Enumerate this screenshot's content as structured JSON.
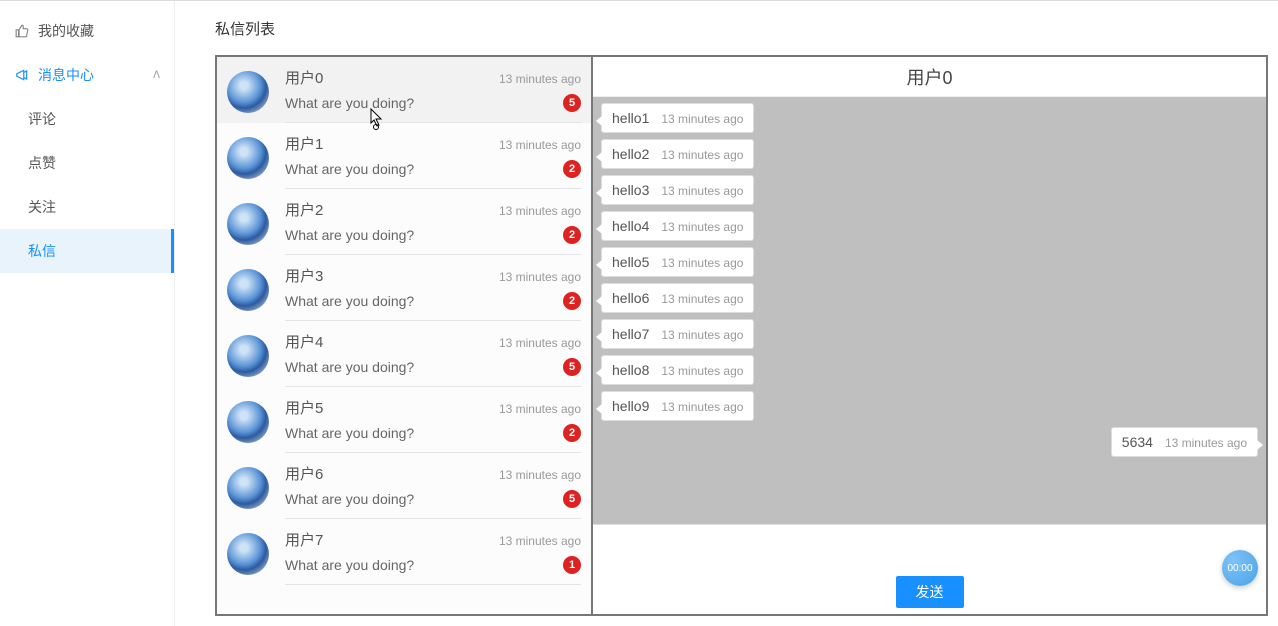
{
  "sidebar": {
    "favorites": "我的收藏",
    "message_center": "消息中心",
    "sub": {
      "comments": "评论",
      "likes": "点赞",
      "follows": "关注",
      "dm": "私信"
    }
  },
  "header": {
    "title": "私信列表"
  },
  "conversations": [
    {
      "name": "用户0",
      "preview": "What are you doing?",
      "time": "13 minutes ago",
      "unread": "5",
      "selected": true
    },
    {
      "name": "用户1",
      "preview": "What are you doing?",
      "time": "13 minutes ago",
      "unread": "2",
      "selected": false
    },
    {
      "name": "用户2",
      "preview": "What are you doing?",
      "time": "13 minutes ago",
      "unread": "2",
      "selected": false
    },
    {
      "name": "用户3",
      "preview": "What are you doing?",
      "time": "13 minutes ago",
      "unread": "2",
      "selected": false
    },
    {
      "name": "用户4",
      "preview": "What are you doing?",
      "time": "13 minutes ago",
      "unread": "5",
      "selected": false
    },
    {
      "name": "用户5",
      "preview": "What are you doing?",
      "time": "13 minutes ago",
      "unread": "2",
      "selected": false
    },
    {
      "name": "用户6",
      "preview": "What are you doing?",
      "time": "13 minutes ago",
      "unread": "5",
      "selected": false
    },
    {
      "name": "用户7",
      "preview": "What are you doing?",
      "time": "13 minutes ago",
      "unread": "1",
      "selected": false
    }
  ],
  "chat": {
    "title": "用户0",
    "messages": [
      {
        "side": "left",
        "text": "hello1",
        "time": "13 minutes ago"
      },
      {
        "side": "left",
        "text": "hello2",
        "time": "13 minutes ago"
      },
      {
        "side": "left",
        "text": "hello3",
        "time": "13 minutes ago"
      },
      {
        "side": "left",
        "text": "hello4",
        "time": "13 minutes ago"
      },
      {
        "side": "left",
        "text": "hello5",
        "time": "13 minutes ago"
      },
      {
        "side": "left",
        "text": "hello6",
        "time": "13 minutes ago"
      },
      {
        "side": "left",
        "text": "hello7",
        "time": "13 minutes ago"
      },
      {
        "side": "left",
        "text": "hello8",
        "time": "13 minutes ago"
      },
      {
        "side": "left",
        "text": "hello9",
        "time": "13 minutes ago"
      },
      {
        "side": "right",
        "text": "5634",
        "time": "13 minutes ago"
      }
    ],
    "send_label": "发送"
  },
  "floating_timer": "00:00"
}
